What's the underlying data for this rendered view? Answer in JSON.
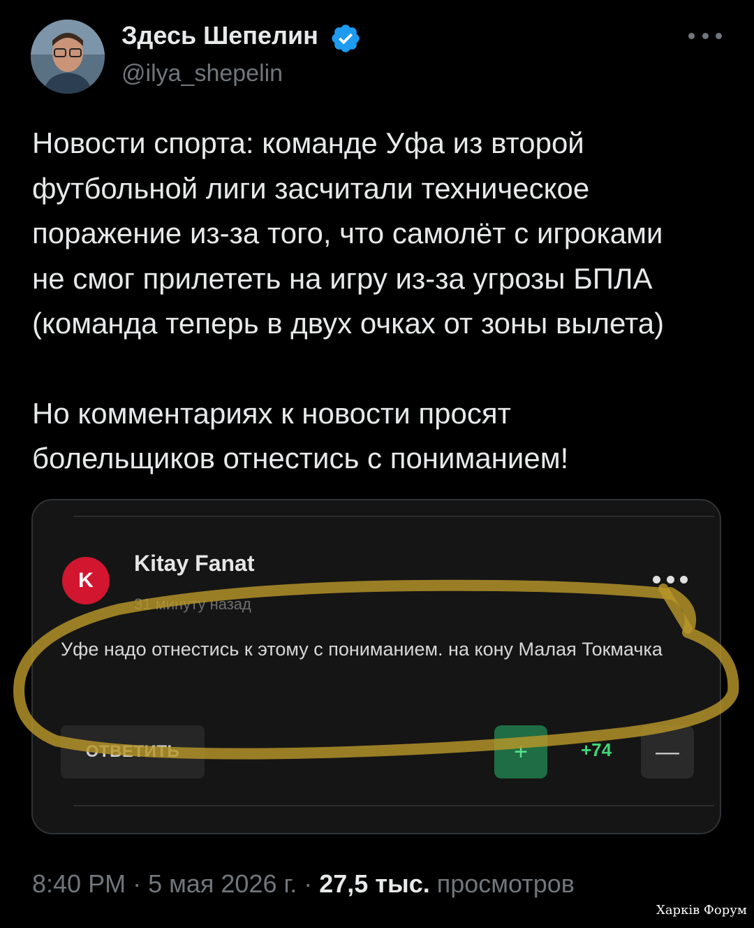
{
  "tweet": {
    "author_name": "Здесь Шепелин",
    "handle": "@ilya_shepelin",
    "text_paragraph_1": "Новости спорта: команде Уфа из второй\nфутбольной лиги засчитали техническое\nпоражение из-за того, что самолёт с игроками\nне смог прилететь на игру из-за угрозы БПЛА\n(команда теперь в двух очках от зоны вылета)",
    "text_paragraph_2": "Но комментариях к новости просят\nболельщиков отнестись с пониманием!",
    "time": "8:40 PM",
    "date": "5 мая 2026 г.",
    "views_count": "27,5 тыс.",
    "views_label": "просмотров",
    "separator": "·"
  },
  "embedded_comment": {
    "avatar_letter": "K",
    "author": "Kitay Fanat",
    "timestamp": "31 минуту назад",
    "text": "Уфе надо отнестись к этому с пониманием. на кону Малая Токмачка",
    "reply_label": "ОТВЕТИТЬ",
    "upvote_symbol": "+",
    "score": "+74",
    "downvote_symbol": "—"
  },
  "watermark": "Харків Форум",
  "colors": {
    "background": "#000000",
    "verified_badge": "#1d9bf0",
    "comment_avatar": "#d2162f",
    "upvote_bg": "#1f6d44",
    "score": "#3fd678",
    "highlight_scribble": "#b8962a"
  },
  "icons": {
    "verified": "verified-badge-icon",
    "more": "more-dots-icon"
  }
}
